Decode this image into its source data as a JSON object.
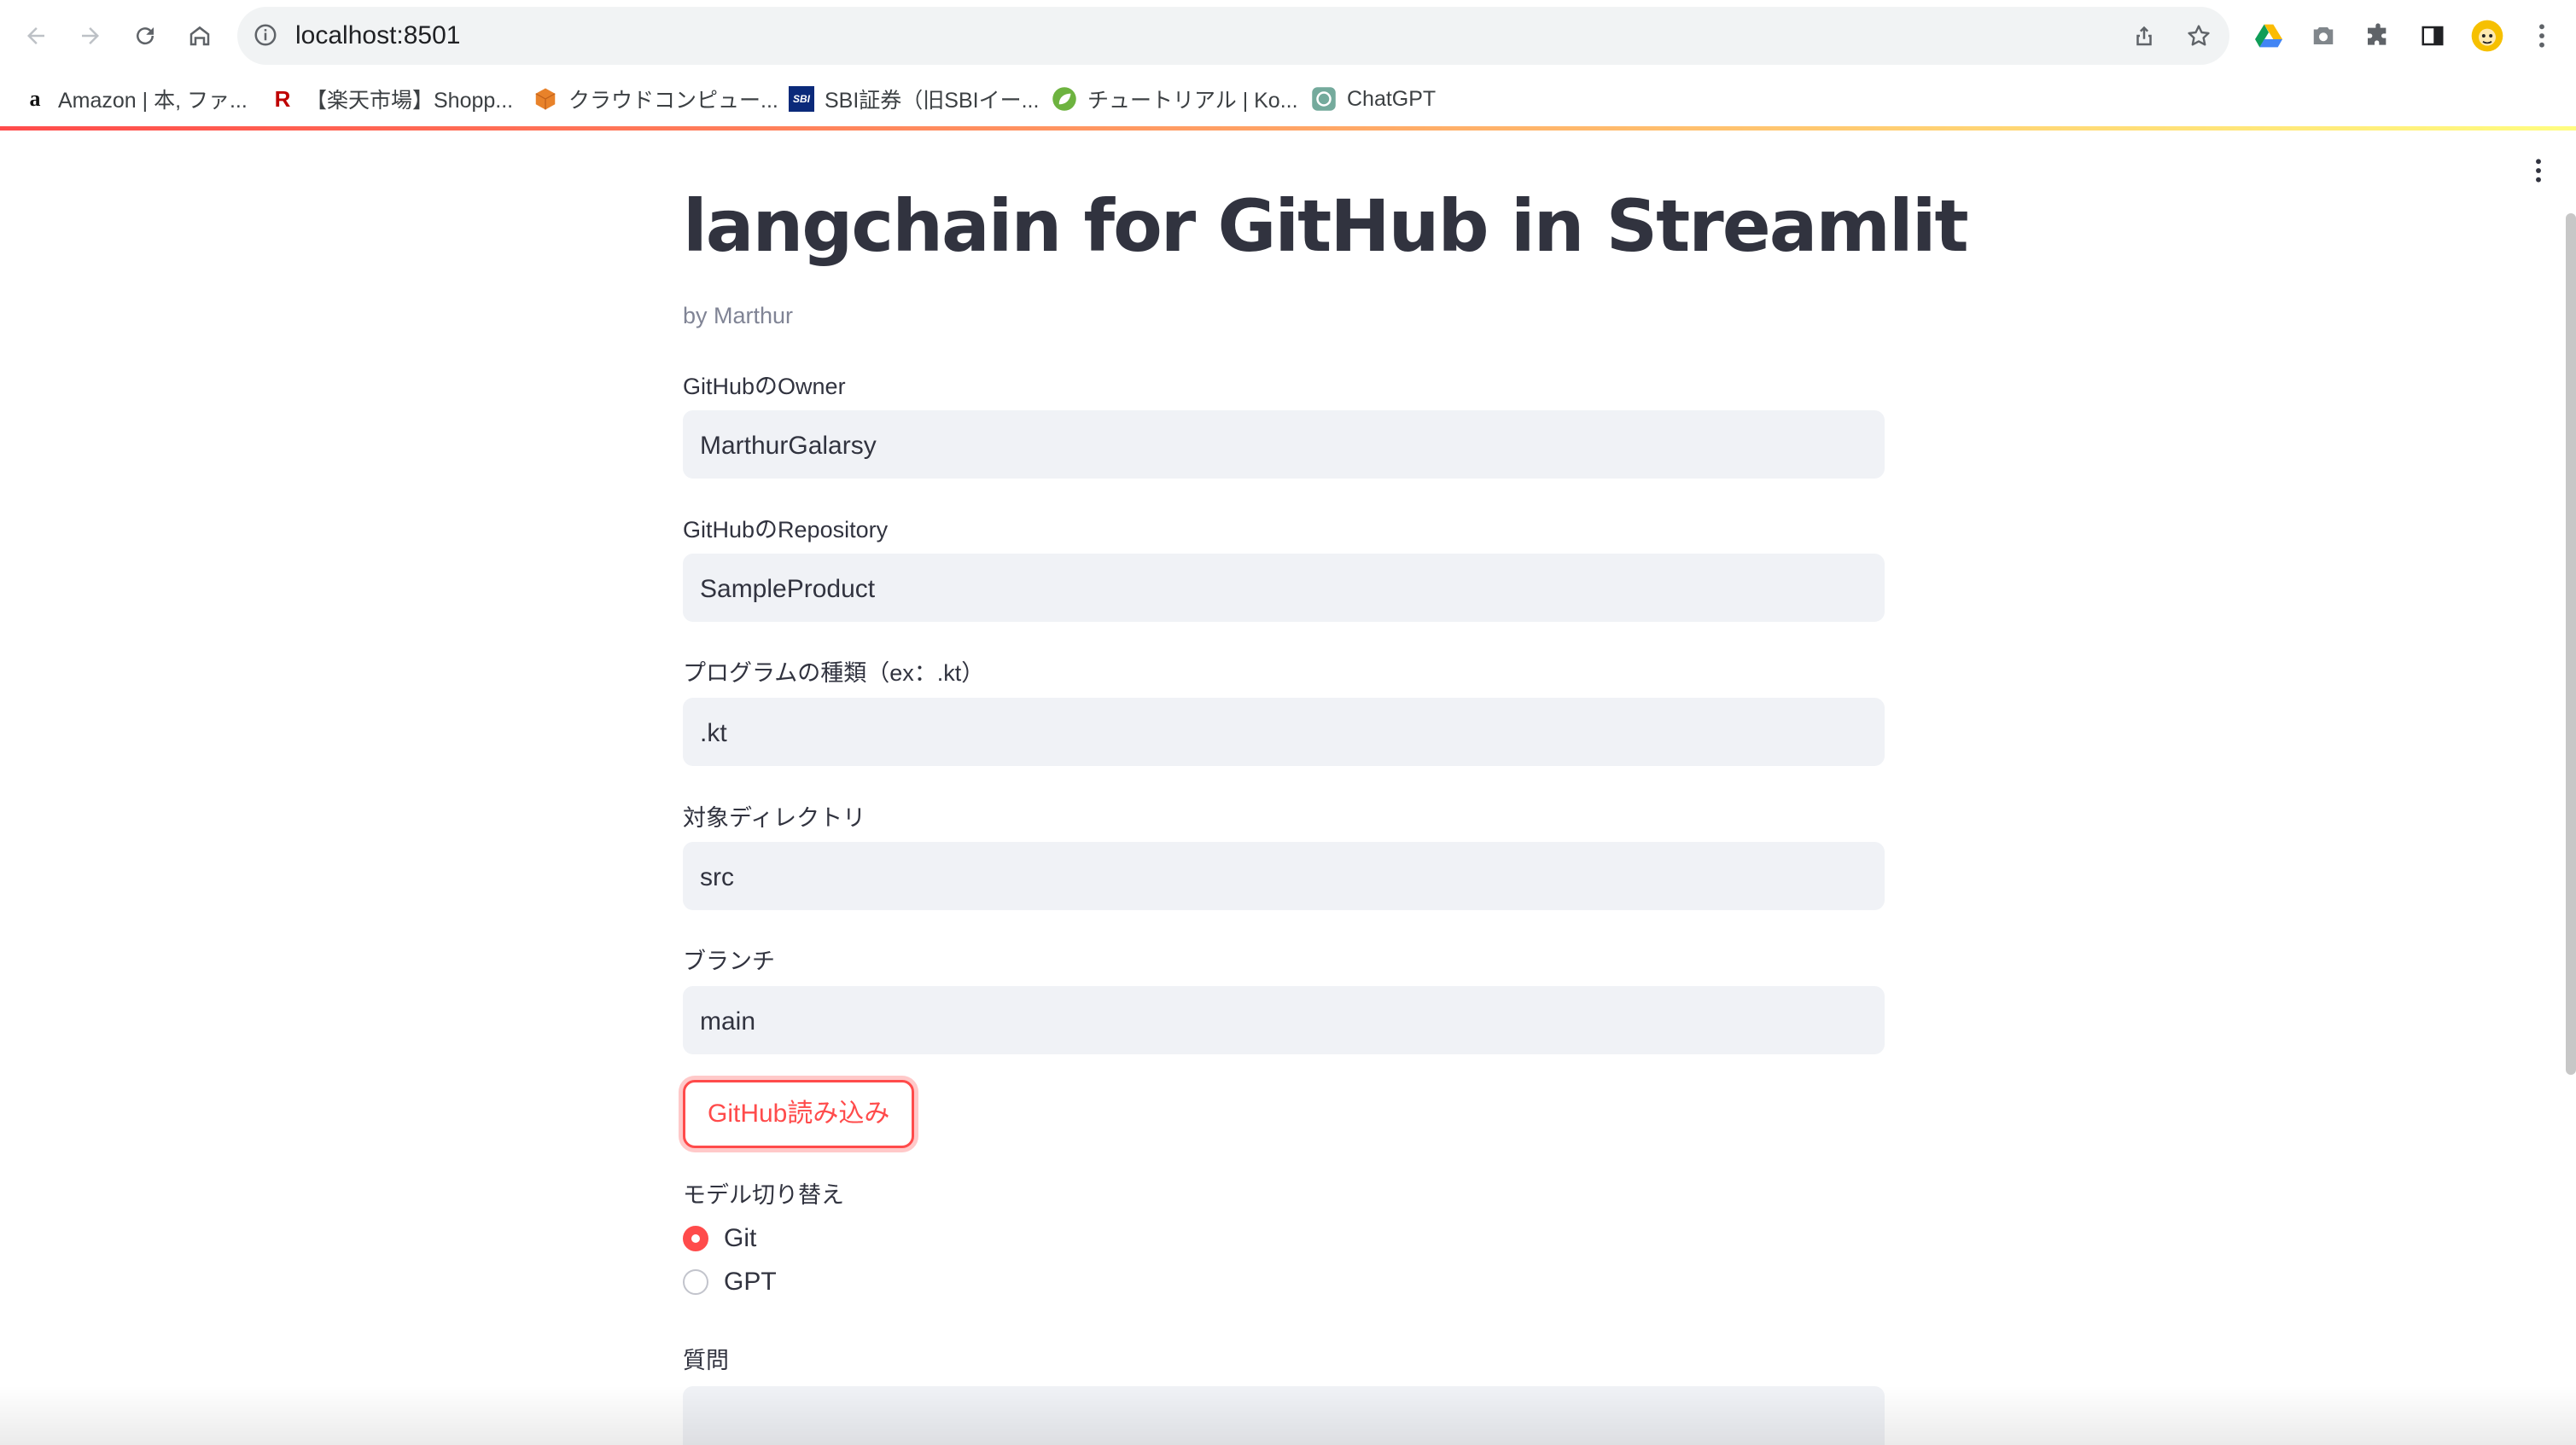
{
  "browser": {
    "url": "localhost:8501",
    "bookmarks": [
      {
        "label": "Amazon | 本, ファ...",
        "icon": "amazon-icon"
      },
      {
        "label": "【楽天市場】Shopp...",
        "icon": "rakuten-icon"
      },
      {
        "label": "クラウドコンピュー...",
        "icon": "aws-cube-icon"
      },
      {
        "label": "SBI証券（旧SBIイー...",
        "icon": "sbi-icon"
      },
      {
        "label": "チュートリアル | Ko...",
        "icon": "spring-leaf-icon"
      },
      {
        "label": "ChatGPT",
        "icon": "chatgpt-icon"
      }
    ]
  },
  "app": {
    "title": "langchain for GitHub in Streamlit",
    "byline": "by Marthur",
    "fields": {
      "owner": {
        "label": "GitHubのOwner",
        "value": "MarthurGalarsy"
      },
      "repository": {
        "label": "GitHubのRepository",
        "value": "SampleProduct"
      },
      "program_type": {
        "label": "プログラムの種類（ex：.kt）",
        "value": ".kt"
      },
      "directory": {
        "label": "対象ディレクトリ",
        "value": "src"
      },
      "branch": {
        "label": "ブランチ",
        "value": "main"
      }
    },
    "load_button": "GitHub読み込み",
    "model_switch": {
      "label": "モデル切り替え",
      "options": [
        {
          "label": "Git",
          "selected": true
        },
        {
          "label": "GPT",
          "selected": false
        }
      ]
    },
    "question": {
      "label": "質問",
      "value": ""
    }
  },
  "colors": {
    "accent": "#ff4b4b",
    "input_bg": "#f0f2f6",
    "text": "#31333f",
    "muted": "#808495"
  }
}
